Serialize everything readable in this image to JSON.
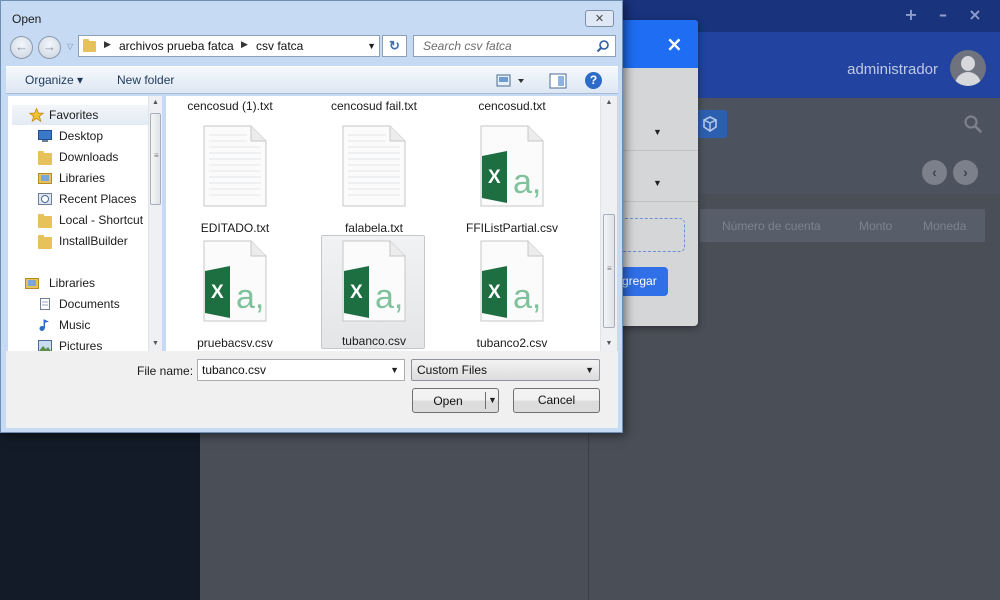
{
  "app": {
    "window_controls": [
      "+",
      "–",
      "×"
    ],
    "user_name": "administrador",
    "table_headers": [
      "Número de cuenta",
      "Monto",
      "Moneda"
    ],
    "pager": {
      "prev": "‹",
      "next": "›"
    }
  },
  "bg_modal": {
    "close_label": "×",
    "caret": "▼",
    "add_button_label": "gregar"
  },
  "dialog": {
    "title": "Open",
    "close_label": "✕",
    "nav": {
      "back": "←",
      "forward": "→"
    },
    "address": {
      "segments": [
        "archivos prueba fatca",
        "csv fatca"
      ],
      "separator": "▶",
      "dropdown": "▼"
    },
    "refresh_label": "↻",
    "search": {
      "placeholder": "Search csv fatca",
      "value": ""
    },
    "toolbar": {
      "organize_label": "Organize ▾",
      "new_folder_label": "New folder",
      "help_label": "?"
    },
    "nav_pane": {
      "items": [
        {
          "label": "Favorites",
          "icon": "star-icon"
        },
        {
          "label": "Desktop",
          "icon": "desktop-icon"
        },
        {
          "label": "Downloads",
          "icon": "folder-icon"
        },
        {
          "label": "Libraries",
          "icon": "libraries-icon"
        },
        {
          "label": "Recent Places",
          "icon": "recent-places-icon"
        },
        {
          "label": "Local - Shortcut",
          "icon": "folder-icon"
        },
        {
          "label": "InstallBuilder",
          "icon": "folder-icon"
        },
        {
          "label": "Libraries",
          "icon": "libraries-icon"
        },
        {
          "label": "Documents",
          "icon": "documents-icon"
        },
        {
          "label": "Music",
          "icon": "music-icon"
        },
        {
          "label": "Pictures",
          "icon": "pictures-icon"
        }
      ]
    },
    "files": {
      "top_row": [
        "cencosud (1).txt",
        "cencosud fail.txt",
        "cencosud.txt"
      ],
      "items": [
        {
          "name": "EDITADO.txt",
          "type": "txt"
        },
        {
          "name": "falabela.txt",
          "type": "txt"
        },
        {
          "name": "FFIListPartial.csv",
          "type": "csv"
        },
        {
          "name": "pruebacsv.csv",
          "type": "csv"
        },
        {
          "name": "tubanco.csv",
          "type": "csv",
          "selected": true
        },
        {
          "name": "tubanco2.csv",
          "type": "csv"
        }
      ],
      "excel_glyph": "X",
      "excel_letter": "a,"
    },
    "bottom": {
      "file_name_label": "File name:",
      "file_name_value": "tubanco.csv",
      "file_type_value": "Custom Files",
      "open_label": "Open",
      "cancel_label": "Cancel",
      "dropdown": "▼"
    }
  },
  "colors": {
    "app_titlebar": "#19337d",
    "app_header": "#22439f",
    "modal_header": "#1e6df3",
    "excel_green": "#1d6f42",
    "excel_letter": "#7fc29b"
  }
}
